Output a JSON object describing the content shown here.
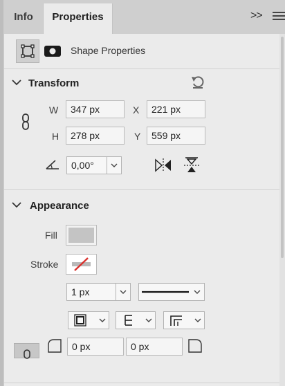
{
  "tabs": {
    "info": "Info",
    "properties": "Properties"
  },
  "header": {
    "expand_icon": "double-chevron-right",
    "menu_icon": "hamburger-menu"
  },
  "shape": {
    "label": "Shape Properties"
  },
  "transform": {
    "title": "Transform",
    "w_label": "W",
    "w_value": "347 px",
    "x_label": "X",
    "x_value": "221 px",
    "h_label": "H",
    "h_value": "278 px",
    "y_label": "Y",
    "y_value": "559 px",
    "angle_value": "0,00°"
  },
  "appearance": {
    "title": "Appearance",
    "fill_label": "Fill",
    "stroke_label": "Stroke",
    "stroke_width": "1 px",
    "radius_left": "0 px",
    "radius_right": "0 px"
  },
  "colors": {
    "fill": "#c4c4c4",
    "stroke_none": "#d9302c"
  }
}
